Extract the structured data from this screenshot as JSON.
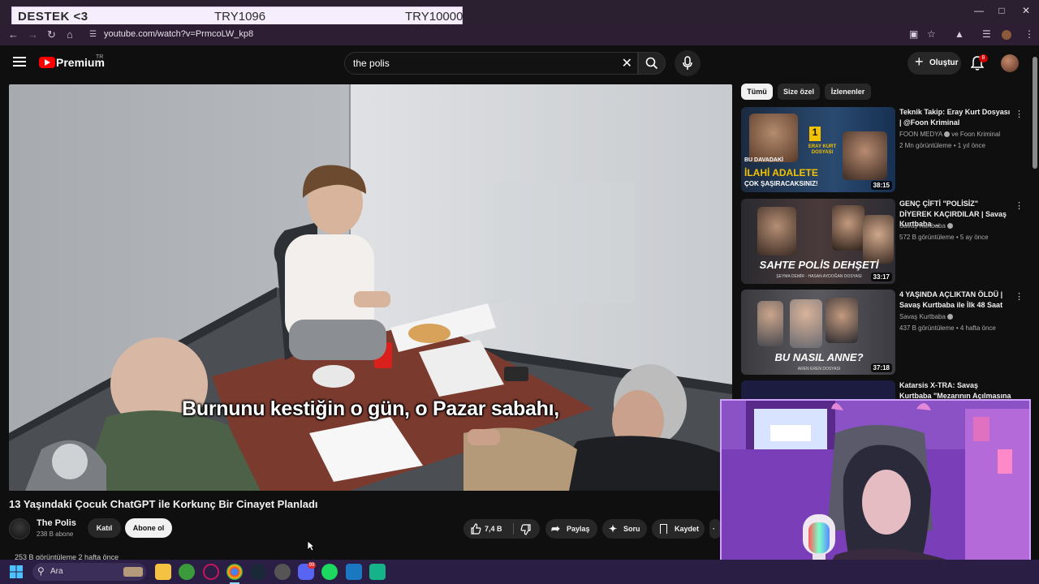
{
  "overlay": {
    "left": "DESTEK <3",
    "mid": "TRY1096",
    "right": "TRY10000"
  },
  "browser": {
    "url": "youtube.com/watch?v=PrmcoLW_kp8"
  },
  "header": {
    "brand": "Premium",
    "region": "TR",
    "search_value": "the polis",
    "create_label": "Oluştur",
    "notif_count": "8"
  },
  "video": {
    "subtitle": "Burnunu kestiğin o gün, o Pazar sabahı,",
    "title": "13 Yaşındaki Çocuk ChatGPT ile Korkunç Bir Cinayet Planladı",
    "channel": "The Polis",
    "subscribers": "238 B abone",
    "join_label": "Katıl",
    "subscribe_label": "Abone ol",
    "likes": "7,4 B",
    "share_label": "Paylaş",
    "ask_label": "Soru",
    "save_label": "Kaydet",
    "views_line": "253 B görüntüleme  2 hafta önce"
  },
  "chips": [
    "Tümü",
    "Size özel",
    "İzlenenler"
  ],
  "recommendations": [
    {
      "title": "Teknik Takip: Eray Kurt Dosyası | @Foon Kriminal",
      "channel": "FOON MEDYA",
      "channel2": "ve Foon Kriminal",
      "meta": "2 Mn görüntüleme • 1 yıl önce",
      "duration": "38:15",
      "thumb_text1": "BU DAVADAKİ",
      "thumb_text2": "İLAHİ ADALETE",
      "thumb_text3": "ÇOK ŞAŞIRACAKSINIZ!",
      "thumb_badge": "ERAY KURT DOSYASI",
      "thumb_number": "1"
    },
    {
      "title": "GENÇ ÇİFTİ \"POLİSİZ\" DİYEREK KAÇIRDILAR | Savaş Kurtbaba ...",
      "channel": "Savaş Kurtbaba",
      "meta": "572 B görüntüleme • 5 ay önce",
      "duration": "33:17",
      "thumb_text1": "SAHTE POLİS DEHŞETİ",
      "thumb_text2": "ŞEYMA DEMİR - HASAN AYDOĞAN DOSYASI"
    },
    {
      "title": "4 YAŞINDA AÇLIKTAN ÖLDÜ | Savaş Kurtbaba ile İlk 48 Saat",
      "channel": "Savaş Kurtbaba",
      "meta": "437 B görüntüleme • 4 hafta önce",
      "duration": "37:18",
      "thumb_text1": "BU NASIL ANNE?",
      "thumb_text2": "AREN EREN DOSYASI"
    },
    {
      "title": "Katarsis X-TRA: Savaş Kurtbaba \"Mezarının Açılmasına Neden ..."
    }
  ],
  "taskbar": {
    "search_label": "Ara",
    "discord_badge": "99"
  },
  "colors": {
    "accent": "#ff0000",
    "webcam_border": "#cfa2ff",
    "taskbar": "#2a1e44"
  }
}
